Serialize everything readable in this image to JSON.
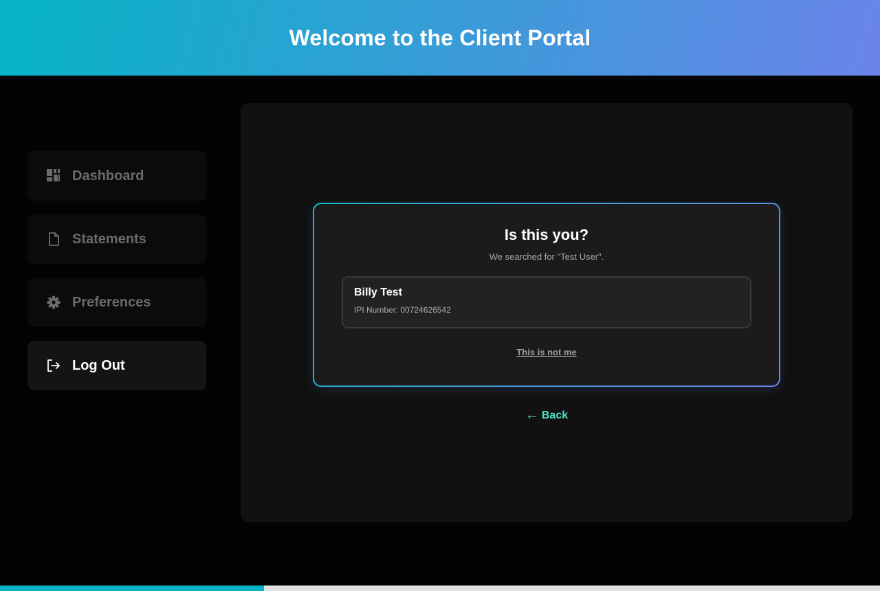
{
  "header": {
    "title": "Welcome to the Client Portal"
  },
  "sidebar": {
    "items": [
      {
        "label": "Dashboard",
        "icon": "dashboard-icon",
        "active": false
      },
      {
        "label": "Statements",
        "icon": "document-icon",
        "active": false
      },
      {
        "label": "Preferences",
        "icon": "gear-icon",
        "active": false
      },
      {
        "label": "Log Out",
        "icon": "logout-icon",
        "active": true
      }
    ]
  },
  "dialog": {
    "title": "Is this you?",
    "subtitle": "We searched for \"Test User\".",
    "result": {
      "name": "Billy Test",
      "ipi": "IPI Number: 00724626542"
    },
    "not_me_label": "This is not me"
  },
  "back": {
    "arrow": "←",
    "label": "Back"
  },
  "progress": {
    "fraction": 0.3
  },
  "colors": {
    "accent": "#06b4c6",
    "accent_end": "#6c84ea",
    "link": "#4fe0c9",
    "background": "#030303",
    "panel": "#111111"
  }
}
